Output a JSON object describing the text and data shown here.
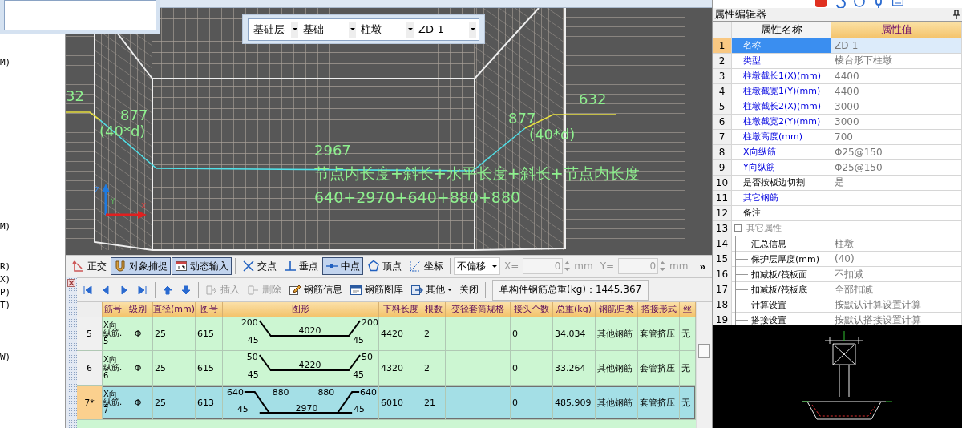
{
  "left_panel": {
    "fragments": [
      "M)",
      "M)",
      "R)",
      "X)",
      "P)",
      "T)",
      "W)"
    ]
  },
  "viewport": {
    "selectors": [
      {
        "value": "基础层"
      },
      {
        "value": "基础"
      },
      {
        "value": "柱墩"
      },
      {
        "value": "ZD-1"
      }
    ],
    "annotations": [
      {
        "kind": "dimension",
        "text": "32"
      },
      {
        "kind": "dimension",
        "text": "877"
      },
      {
        "kind": "dimension",
        "text": "(40*d)"
      },
      {
        "kind": "dimension",
        "text": "877"
      },
      {
        "kind": "dimension",
        "text": "(40*d)"
      },
      {
        "kind": "dimension",
        "text": "632"
      },
      {
        "kind": "dimension",
        "text": "2967"
      },
      {
        "kind": "formula",
        "text": "节点内长度+斜长+水平长度+斜长+节点内长度"
      },
      {
        "kind": "formula",
        "text": "640+2970+640+880+880"
      }
    ],
    "axes": [
      "Z",
      "Y",
      "X"
    ]
  },
  "snap_toolbar": {
    "buttons": [
      {
        "label": "正交",
        "on": false
      },
      {
        "label": "对象捕捉",
        "on": true
      },
      {
        "label": "动态输入",
        "on": true
      },
      {
        "label": "交点",
        "on": false
      },
      {
        "label": "垂点",
        "on": false
      },
      {
        "label": "中点",
        "on": true
      },
      {
        "label": "顶点",
        "on": false
      },
      {
        "label": "坐标",
        "on": false
      }
    ],
    "offset_mode": "不偏移",
    "fields_disabled": true,
    "x_label": "X=",
    "x_value": "0",
    "x_unit": "mm",
    "y_label": "Y=",
    "y_value": "0",
    "y_unit": "mm",
    "more": "»"
  },
  "rebar_toolbar": {
    "buttons": [
      {
        "label": "插入",
        "kind": "icon",
        "disabled": true
      },
      {
        "label": "删除",
        "kind": "icon",
        "disabled": true
      },
      {
        "label": "钢筋信息",
        "kind": "icon",
        "disabled": false
      },
      {
        "label": "钢筋图库",
        "kind": "icon",
        "disabled": false
      },
      {
        "label": "其他",
        "kind": "dropdown",
        "disabled": false
      },
      {
        "label": "关闭",
        "kind": "plain",
        "disabled": false
      }
    ],
    "total": "单构件钢筋总重(kg)：1445.367"
  },
  "rebar_table": {
    "columns": [
      "筋号",
      "级别",
      "直径(mm)",
      "图号",
      "图形",
      "下料长度",
      "根数",
      "变径套筒规格",
      "接头个数",
      "总重(kg)",
      "钢筋归类",
      "搭接形式",
      "丝"
    ],
    "rows": [
      {
        "row_no": "5",
        "selected": false,
        "bar_no": "X向纵筋.5",
        "grade": "Φ",
        "diameter": "25",
        "shape_no": "615",
        "shape": {
          "kind": "bent",
          "labels": [
            "200",
            "200",
            "4020",
            "45",
            "45"
          ]
        },
        "cut_length": "4420",
        "count": "2",
        "joints": "0",
        "weight": "34.034",
        "category": "其他钢筋",
        "splice": "套管挤压",
        "column_13": "无"
      },
      {
        "row_no": "6",
        "selected": false,
        "bar_no": "X向纵筋.6",
        "grade": "Φ",
        "diameter": "25",
        "shape_no": "615",
        "shape": {
          "kind": "bent",
          "labels": [
            "50",
            "50",
            "4220",
            "45",
            "45"
          ]
        },
        "cut_length": "4320",
        "count": "2",
        "joints": "0",
        "weight": "33.264",
        "category": "其他钢筋",
        "splice": "套管挤压",
        "column_13": "无"
      },
      {
        "row_no": "7*",
        "selected": true,
        "bar_no": "X向纵筋.7",
        "grade": "Φ",
        "diameter": "25",
        "shape_no": "613",
        "shape": {
          "kind": "crank",
          "labels": [
            "640",
            "880",
            "880",
            "640",
            "45",
            "2970",
            "45"
          ]
        },
        "cut_length": "6010",
        "count": "21",
        "joints": "0",
        "weight": "485.909",
        "category": "其他钢筋",
        "splice": "套管挤压",
        "column_13": "无"
      }
    ]
  },
  "property_editor": {
    "title": "属性编辑器",
    "columns": [
      "属性名称",
      "属性值"
    ],
    "rows": [
      {
        "no": "1",
        "name": "名称",
        "value": "ZD-1",
        "kind": "property",
        "public": true,
        "selected": true
      },
      {
        "no": "2",
        "name": "类型",
        "value": "棱台形下柱墩",
        "kind": "property",
        "public": true,
        "selected": false
      },
      {
        "no": "3",
        "name": "柱墩截长1(X)(mm)",
        "value": "4400",
        "kind": "property",
        "public": true,
        "selected": false
      },
      {
        "no": "4",
        "name": "柱墩截宽1(Y)(mm)",
        "value": "4400",
        "kind": "property",
        "public": true,
        "selected": false
      },
      {
        "no": "5",
        "name": "柱墩截长2(X)(mm)",
        "value": "3000",
        "kind": "property",
        "public": true,
        "selected": false
      },
      {
        "no": "6",
        "name": "柱墩截宽2(Y)(mm)",
        "value": "3000",
        "kind": "property",
        "public": true,
        "selected": false
      },
      {
        "no": "7",
        "name": "柱墩高度(mm)",
        "value": "700",
        "kind": "property",
        "public": true,
        "selected": false
      },
      {
        "no": "8",
        "name": "X向纵筋",
        "value": "Φ25@150",
        "kind": "property",
        "public": true,
        "selected": false
      },
      {
        "no": "9",
        "name": "Y向纵筋",
        "value": "Φ25@150",
        "kind": "property",
        "public": true,
        "selected": false
      },
      {
        "no": "10",
        "name": "是否按板边切割",
        "value": "是",
        "kind": "property",
        "public": false,
        "selected": false
      },
      {
        "no": "11",
        "name": "其它钢筋",
        "kind": "property",
        "public": true,
        "selected": false
      },
      {
        "no": "12",
        "name": "备注",
        "kind": "property",
        "public": false,
        "selected": false
      },
      {
        "no": "13",
        "name": "其它属性",
        "kind": "group",
        "expanded": true,
        "selected": false,
        "children": [
          {
            "no": "14",
            "name": "汇总信息",
            "value": "柱墩",
            "kind": "property",
            "public": false,
            "selected": false
          },
          {
            "no": "15",
            "name": "保护层厚度(mm)",
            "value": "(40)",
            "kind": "property",
            "public": false,
            "selected": false
          },
          {
            "no": "16",
            "name": "扣减板/筏板面",
            "value": "不扣减",
            "kind": "property",
            "public": false,
            "selected": false
          },
          {
            "no": "17",
            "name": "扣减板/筏板底",
            "value": "全部扣减",
            "kind": "property",
            "public": false,
            "selected": false
          },
          {
            "no": "18",
            "name": "计算设置",
            "value": "按默认计算设置计算",
            "kind": "property",
            "public": false,
            "selected": false
          },
          {
            "no": "19",
            "name": "搭接设置",
            "value": "按默认搭接设置计算",
            "kind": "property",
            "public": false,
            "selected": false
          }
        ]
      }
    ]
  }
}
